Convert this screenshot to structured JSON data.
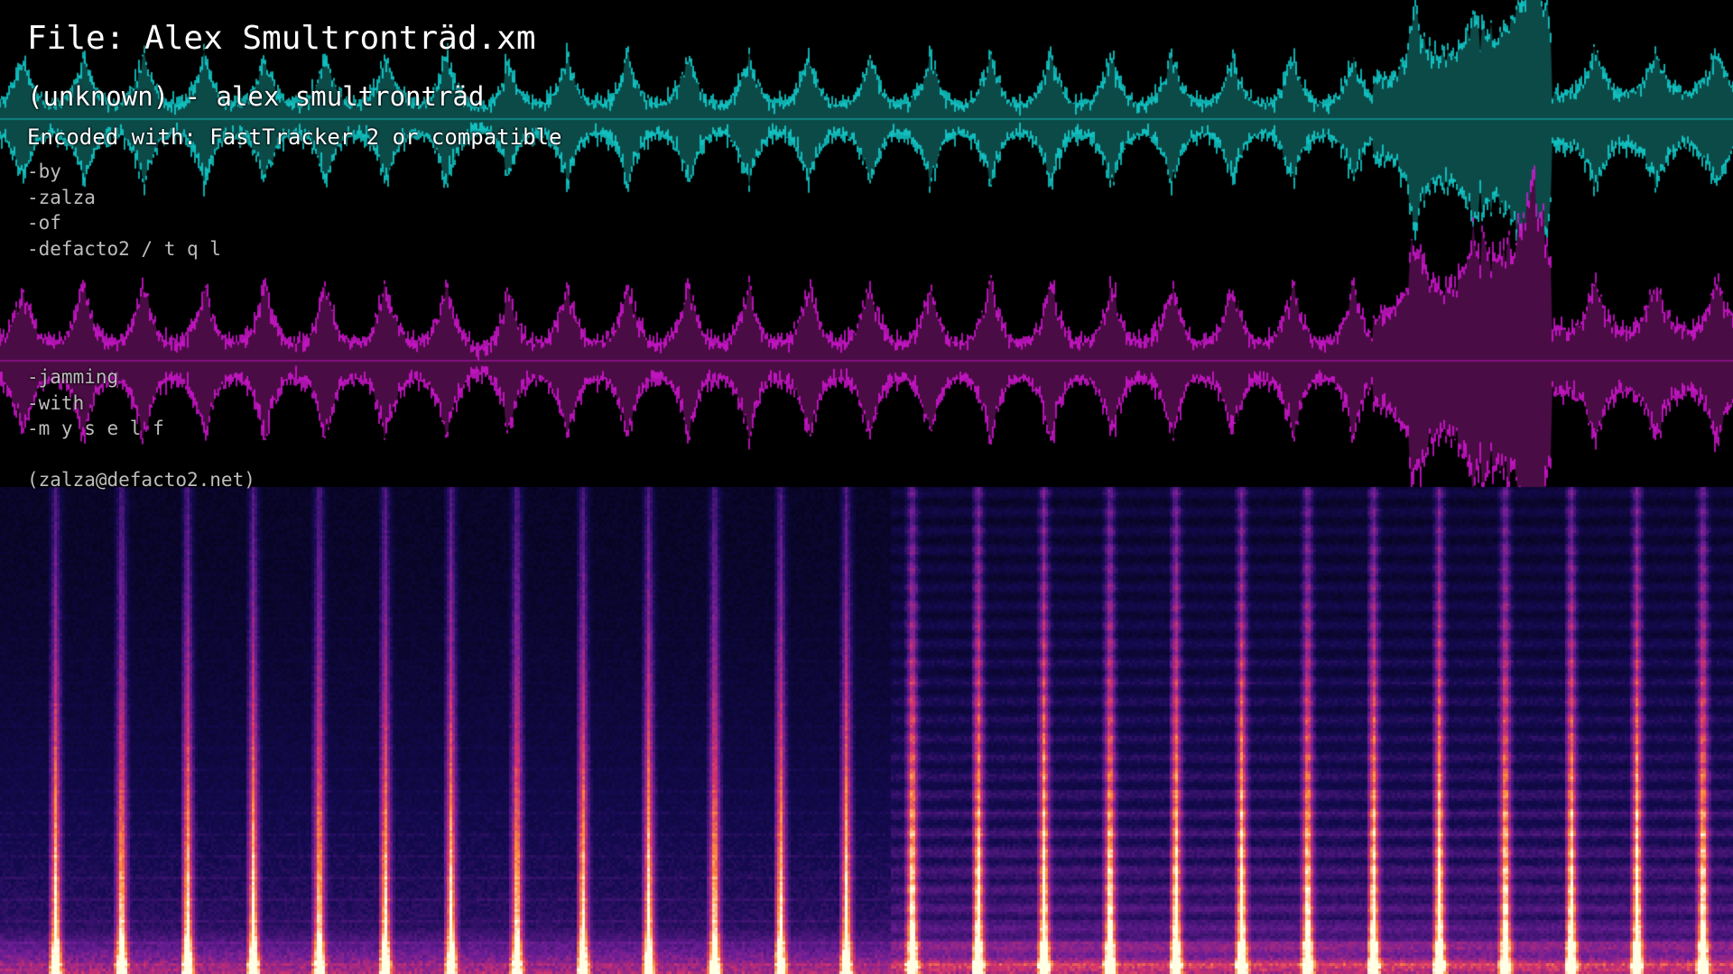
{
  "file_title": "File: Alex Smultronträd.xm",
  "track_line": "(unknown) - alex smultronträd",
  "encoder_line": "Encoded with: FastTracker 2 or compatible",
  "comment_lines": [
    "-by\u0001",
    "-zalza\u0001",
    "-of\u0001",
    "-defacto2 / t q l\u0001",
    "\u0001",
    "\u0001",
    "\u0001",
    "\u0001",
    "-jamming\u0001",
    "-with\u0001",
    "-m y s e l f\u0001",
    "\u0001",
    "(zalza@defacto2.net)"
  ],
  "colors": {
    "background": "#000000",
    "left_channel_waveform": "#14e6e6",
    "left_channel_fill": "#0c4a48",
    "right_channel_waveform": "#e619e6",
    "right_channel_fill": "#4a0c44",
    "spectrogram_low": "#06052a",
    "spectrogram_mid": "#7a1ea8",
    "spectrogram_high": "#ff9a3c",
    "spectrogram_peak": "#ffffff"
  },
  "visualization": {
    "channels": [
      "left-channel-waveform",
      "right-channel-waveform"
    ],
    "spectrogram": "spectrogram"
  }
}
